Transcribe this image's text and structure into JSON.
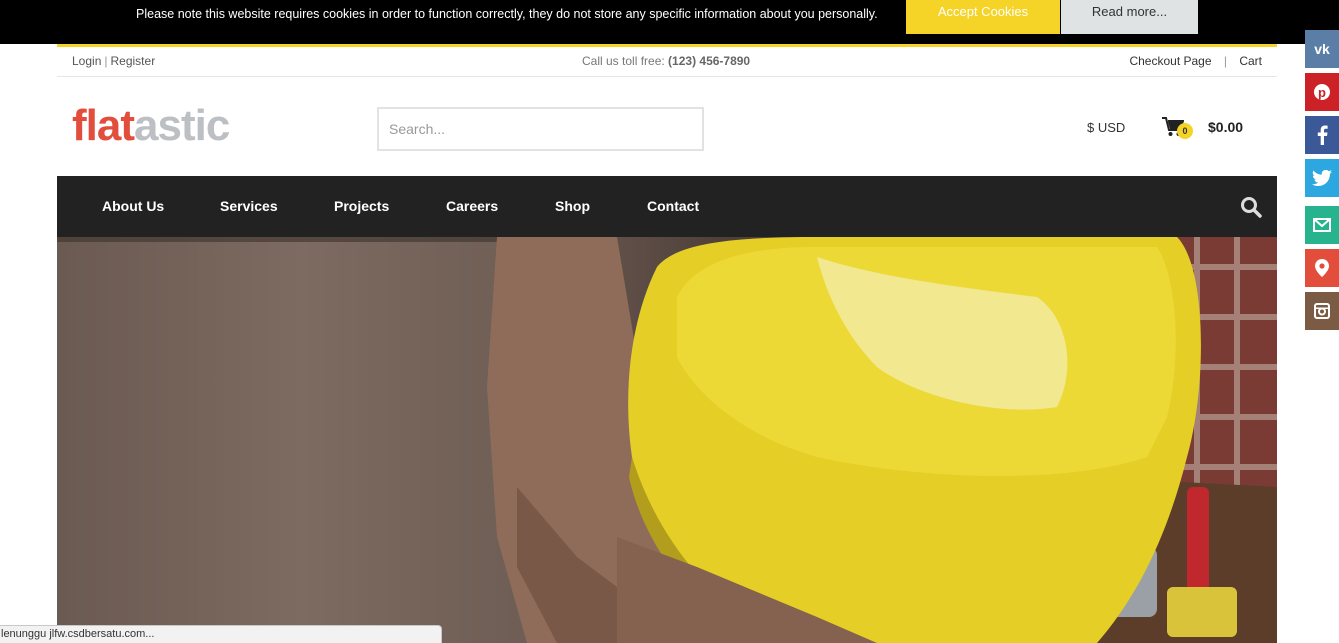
{
  "cookie": {
    "message": "Please note this website requires cookies in order to function correctly, they do not store any specific information about you personally.",
    "accept_label": "Accept Cookies",
    "read_more_label": "Read more..."
  },
  "topbar": {
    "login": "Login",
    "separator": "|",
    "register": "Register",
    "call_label": "Call us toll free:",
    "phone": "(123) 456-7890",
    "checkout": "Checkout Page",
    "cart": "Cart"
  },
  "header": {
    "logo_part1": "flat",
    "logo_part2": "astic",
    "search_placeholder": "Search...",
    "currency": "$ USD",
    "cart_count": "0",
    "cart_total": "$0.00"
  },
  "nav": {
    "items": [
      "About Us",
      "Services",
      "Projects",
      "Careers",
      "Shop",
      "Contact"
    ]
  },
  "social": [
    {
      "name": "vk-icon",
      "color": "#5a7ea6"
    },
    {
      "name": "pinterest-icon",
      "color": "#cc2127"
    },
    {
      "name": "facebook-icon",
      "color": "#3b5998"
    },
    {
      "name": "twitter-icon",
      "color": "#2ca7e0"
    },
    {
      "name": "email-icon",
      "color": "#26b38d"
    },
    {
      "name": "location-icon",
      "color": "#e24d3c"
    },
    {
      "name": "instagram-icon",
      "color": "#7b5b44"
    }
  ],
  "colors": {
    "accent_yellow": "#f5d327",
    "logo_red": "#e24d3c",
    "logo_grey": "#bcc0c4",
    "nav_bg": "#222222"
  },
  "status": {
    "text": "lenunggu jlfw.csdbersatu.com..."
  }
}
